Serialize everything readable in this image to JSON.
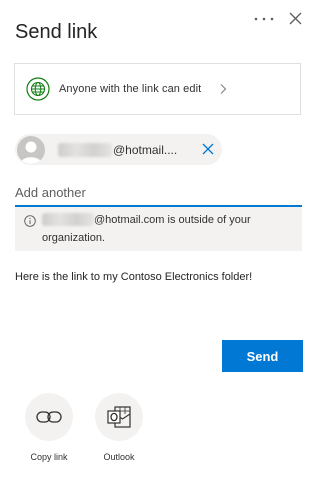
{
  "header": {
    "title": "Send link",
    "more_glyph": "···"
  },
  "permission": {
    "label": "Anyone with the link can edit"
  },
  "recipient": {
    "email_suffix": "@hotmail...."
  },
  "add_field": {
    "placeholder": "Add another",
    "value": ""
  },
  "warning": {
    "line1_suffix": "@hotmail.com is outside of your",
    "line2": "organization."
  },
  "message": {
    "text": "Here is the link to my Contoso Electronics folder!"
  },
  "actions": {
    "send_label": "Send"
  },
  "share_options": [
    {
      "label": "Copy link",
      "icon": "link-icon"
    },
    {
      "label": "Outlook",
      "icon": "outlook-icon"
    }
  ],
  "colors": {
    "accent": "#0078d4",
    "globe": "#107c10",
    "panel": "#f3f2f1"
  }
}
